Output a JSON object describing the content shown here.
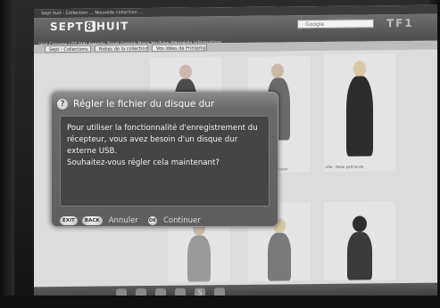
{
  "browser": {
    "title_bar": "Sept huit - Collection ... Nouvelle collection ...",
    "logo_prefix": "SEPT",
    "logo_digit": "8",
    "logo_suffix": "HUIT",
    "search_placeholder": "Google",
    "channel_logo": "TF1",
    "bookmarks": "Vial  Corsage  LOT MAI  Agenda  Trinet  Google Maps  YouTube  Wikipédia  Informations",
    "tabs": [
      "Sept - Collections",
      "Robes de la collection",
      "Vos idées de Printemps"
    ]
  },
  "product_captions": [
    "Robe - Robe en coton",
    "Vila - Robe patineuse"
  ],
  "dialog": {
    "title": "Régler le fichier du disque dur",
    "message_lines": [
      "Pour utiliser la fonctionnalité d'enregistrement du",
      "récepteur, vous avez besoin d'un disque dur externe USB.",
      "Souhaitez-vous régler cela maintenant?"
    ],
    "exit_key": "EXIT",
    "back_key": "BACK",
    "cancel_label": "Annuler",
    "ok_key": "OK",
    "continue_label": "Continuer"
  },
  "taskbar_icons": [
    "app-icon",
    "app-icon",
    "app-icon",
    "app-icon",
    "S",
    "app-icon"
  ]
}
